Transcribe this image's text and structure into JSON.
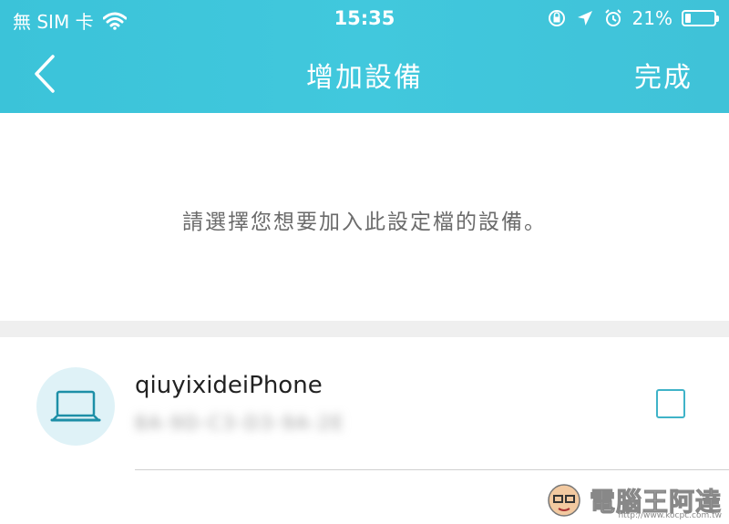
{
  "status_bar": {
    "carrier": "無 SIM 卡",
    "time": "15:35",
    "battery": "21%",
    "battery_level": 0.21
  },
  "nav": {
    "title": "增加設備",
    "done_label": "完成"
  },
  "instruction": "請選擇您想要加入此設定檔的設備。",
  "devices": [
    {
      "name": "qiuyixideiPhone",
      "mac": "8A-9D-C3-D3-9A-2E",
      "icon": "laptop-icon",
      "checked": false
    }
  ],
  "colors": {
    "header": "#41c8dd",
    "accent": "#3fb3c8",
    "avatar_bg": "#dff2f7"
  },
  "watermark": {
    "logo_text": "電腦王阿達",
    "url": "http://www.kocpc.com.tw"
  }
}
